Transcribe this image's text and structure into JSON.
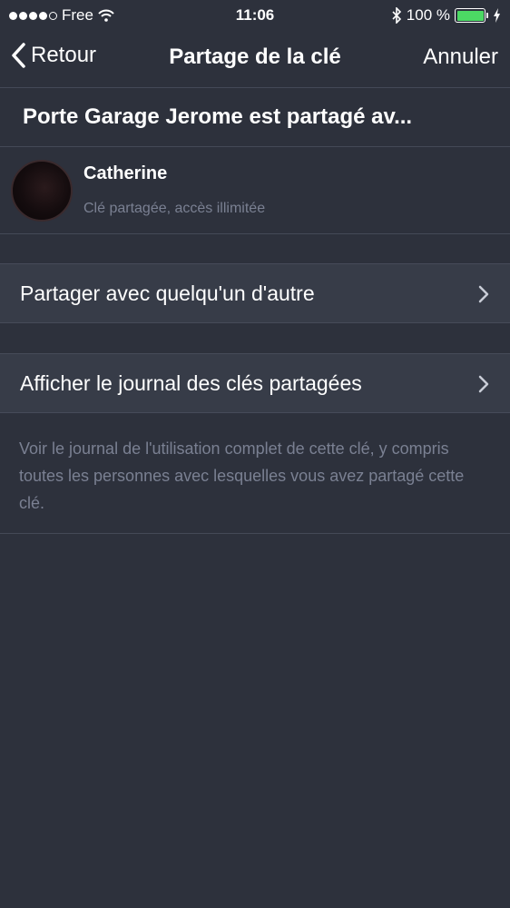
{
  "status_bar": {
    "carrier": "Free",
    "time": "11:06",
    "battery": "100 %",
    "battery_level": 1.0
  },
  "nav": {
    "back_label": "Retour",
    "title": "Partage de la clé",
    "cancel_label": "Annuler"
  },
  "shared_header": "Porte Garage Jerome est partagé av...",
  "user": {
    "name": "Catherine",
    "subtitle": "Clé partagée, accès illimitée"
  },
  "actions": {
    "share_other": "Partager avec quelqu'un d'autre",
    "show_log": "Afficher le journal des clés partagées"
  },
  "footnote": "Voir le journal de l'utilisation complet de cette clé, y compris toutes les personnes avec lesquelles vous avez partagé cette clé.",
  "colors": {
    "background": "#2d313c",
    "cell": "#373c48",
    "secondary_text": "#7a8092",
    "battery": "#4cd964"
  }
}
